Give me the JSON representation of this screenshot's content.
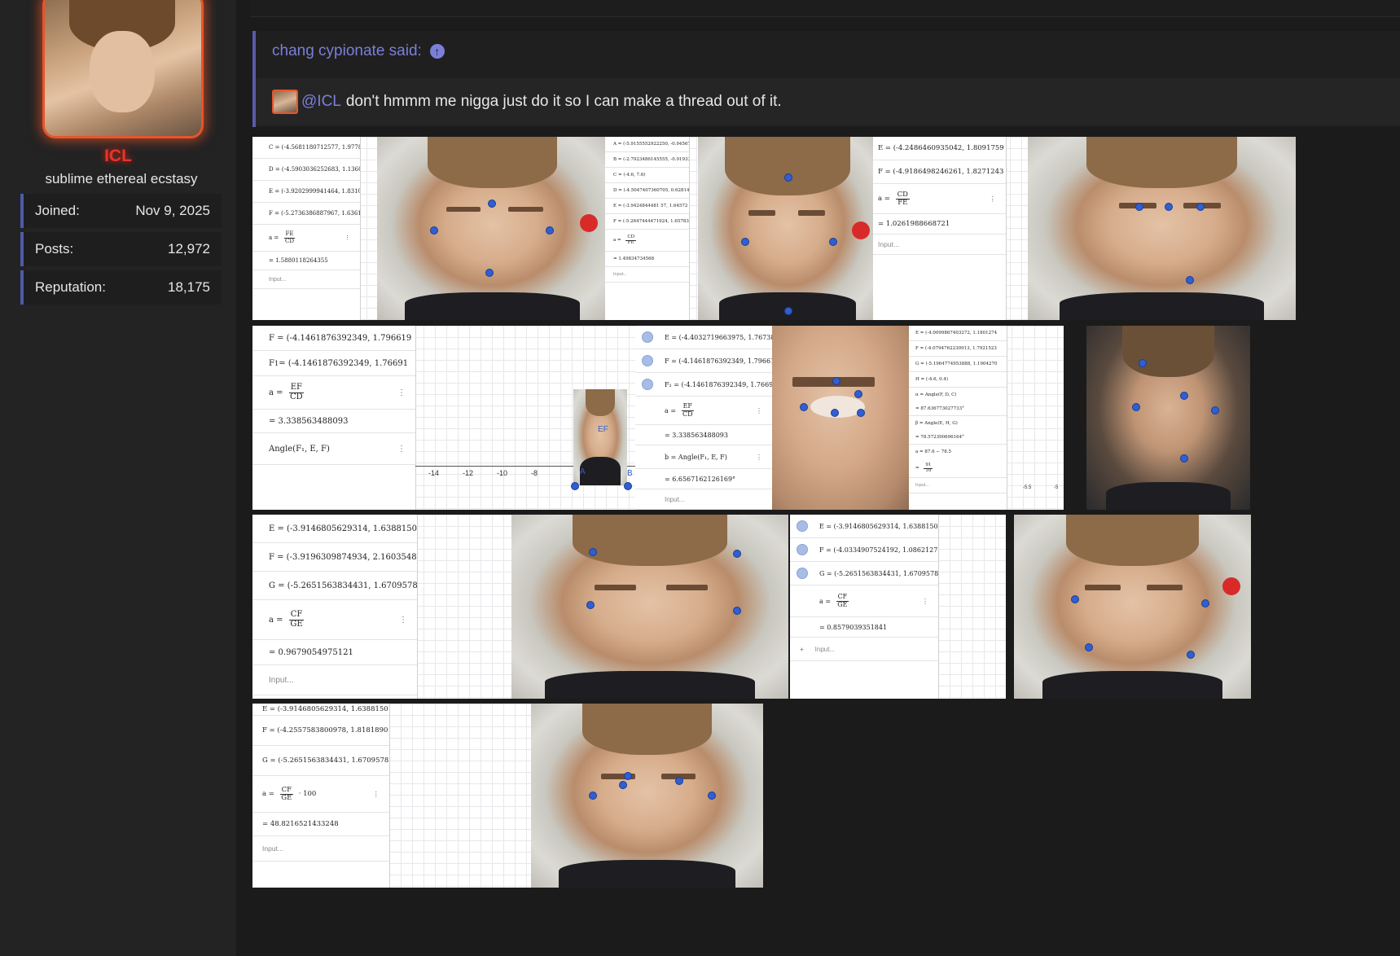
{
  "user": {
    "name": "ICL",
    "title": "sublime ethereal ecstasy",
    "stats": [
      {
        "label": "Joined:",
        "value": "Nov 9, 2025"
      },
      {
        "label": "Posts:",
        "value": "12,972"
      },
      {
        "label": "Reputation:",
        "value": "18,175"
      }
    ]
  },
  "quote": {
    "author_line": "chang cypionate said:",
    "mention": "@ICL",
    "text": "don't hmmm me nigga just do it so I can make a thread out of it."
  },
  "strip1": {
    "a_rows": [
      "C = (-4.5681180712577, 1.977861",
      "D = (-4.5903036252683, 1.13608",
      "E = (-3.9202999941464, 1.8310814",
      "F = (-5.2736386887967, 1.6361585"
    ],
    "a_formula_num": "FE",
    "a_formula_den": "CD",
    "a_result": "= 1.5880118264355",
    "a_input": "Input...",
    "b_rows": [
      "A = (-5.9155552922250, -0.945670",
      "B = (-2.7923486145555, -0.919336",
      "C = (-4.6, 7.6)",
      "D = (-4.5047407360705, 0.62814",
      "E = (-3.9424844481 57, 1.64572",
      "F = (-5.2647444471924, 1.657833"
    ],
    "b_formula_num": "CD",
    "b_formula_den": "FE",
    "b_result": "= 1.49834734568",
    "b_input": "Input...",
    "c_rows": [
      "E = (-4.2486460935042, 1.8091759",
      "F = (-4.9186498246261, 1.8271243"
    ],
    "c_formula_num": "CD",
    "c_formula_den": "FE",
    "c_result": "= 1.0261988668721",
    "c_input": "Input..."
  },
  "strip2": {
    "a_rows": [
      "F = (-4.1461876392349, 1.796619"
    ],
    "a_f1": "F",
    "a_f1_sub": "1",
    "a_f1_rest": " = (-4.1461876392349, 1.76691",
    "a_formula_num": "EF",
    "a_formula_den": "CD",
    "a_result": "= 3.338563488093",
    "a_angle": "Angle(F₁,  E,  F)",
    "axis_ticks": [
      "-14",
      "-12",
      "-10",
      "-8"
    ],
    "point_labels": [
      "A",
      "B",
      "EF"
    ],
    "b_rows": [
      "E = (-4.4032719663975, 1.767380",
      "F = (-4.1461876392349, 1.796619",
      "F₁ = (-4.1461876392349, 1.76691"
    ],
    "b_formula_num": "EF",
    "b_formula_den": "CD",
    "b_result": "= 3.338563488093",
    "b_angle": "b = Angle(F₁, E, F)",
    "b_angle_result": "= 6.6567162126169°",
    "b_input": "Input...",
    "c_rows": [
      "E = (-4.0099867403272, 1.1801274",
      "F = (-4.0794762230913, 1.7921523",
      "G = (-5.1964774953888, 1.1904270",
      "H = (-4.6, 0.4)",
      "α = Angle(F, D, C)",
      "= 87.636773027733°",
      "β = Angle(E, H, G)",
      "= 78.572390696164°",
      "a = 87.6 − 78.5"
    ],
    "c_fraction_num": "91",
    "c_fraction_den": "10",
    "c_input": "Input...",
    "c_axis": [
      "-5.5",
      "-5"
    ]
  },
  "strip3": {
    "a_rows": [
      "E = (-3.9146805629314, 1.6388150",
      "F = (-3.9196309874934, 2.1603548",
      "G = (-5.2651563834431, 1.6709578"
    ],
    "a_formula_num": "CF",
    "a_formula_den": "GE",
    "a_result": "= 0.9679054975121",
    "a_input": "Input...",
    "b_rows": [
      "E = (-3.9146805629314, 1.6388150",
      "F = (-4.0334907524192, 1.0862127",
      "G = (-5.2651563834431, 1.6709578"
    ],
    "b_formula_num": "CF",
    "b_formula_den": "GE",
    "b_result": "= 0.8579039351841",
    "b_input": "Input..."
  },
  "strip4": {
    "a_rows": [
      "E = (-3.9146805629314, 1.6388150",
      "F = (-4.2557583800978, 1.8181890",
      "G = (-5.2651563834431, 1.6709578"
    ],
    "a_formula_num": "CF",
    "a_formula_den": "GE",
    "a_formula_tail": "· 100",
    "a_result": "= 48.8216521433248",
    "a_input": "Input..."
  },
  "colors": {
    "accent": "#7b7fd8",
    "username": "#e8342a",
    "avatar_border": "#e8542a",
    "stat_border": "#4e5aa8"
  },
  "icons": {
    "quote_jump": "arrow-up-circle-icon",
    "row_menu": "kebab-menu-icon"
  }
}
